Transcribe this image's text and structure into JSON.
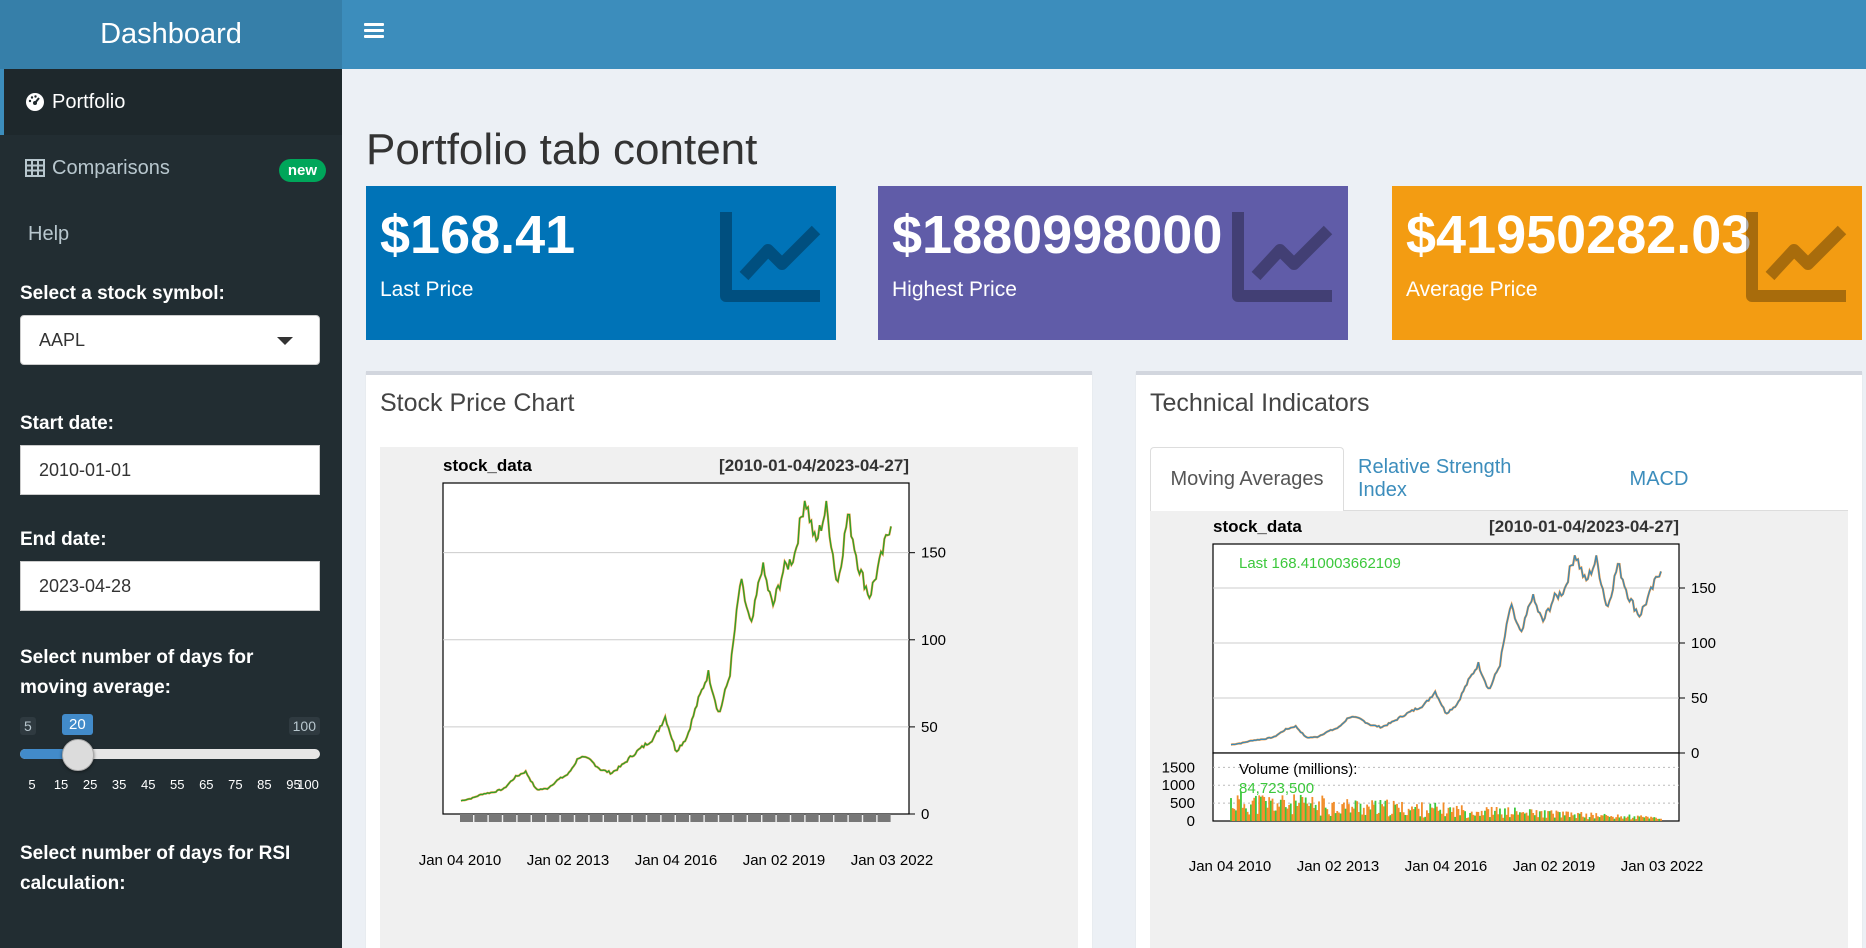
{
  "header": {
    "brand": "Dashboard",
    "menu_icon": "hamburger-icon",
    "colors": {
      "brand_bg": "#367fa9",
      "navbar_bg": "#3c8dbc"
    }
  },
  "sidebar": {
    "items": [
      {
        "label": "Portfolio",
        "icon": "dashboard-icon",
        "active": true
      },
      {
        "label": "Comparisons",
        "icon": "table-icon",
        "badge": "new"
      },
      {
        "label": "Help"
      }
    ],
    "stock_select": {
      "label": "Select a stock symbol:",
      "value": "AAPL"
    },
    "start_date": {
      "label": "Start date:",
      "value": "2010-01-01"
    },
    "end_date": {
      "label": "End date:",
      "value": "2023-04-28"
    },
    "ma_slider": {
      "label": "Select number of days for moving average:",
      "min": "5",
      "max": "100",
      "value": "20",
      "ticks": [
        "5",
        "15",
        "25",
        "35",
        "45",
        "55",
        "65",
        "75",
        "85",
        "95",
        "100"
      ]
    },
    "rsi_label": "Select number of days for RSI calculation:"
  },
  "main": {
    "title": "Portfolio tab content",
    "value_boxes": [
      {
        "value": "$168.41",
        "subtitle": "Last Price",
        "color": "#0073b7",
        "icon": "line-chart-icon"
      },
      {
        "value": "$1880998000",
        "subtitle": "Highest Price",
        "color": "#605ca8",
        "icon": "line-chart-icon"
      },
      {
        "value": "$41950282.03",
        "subtitle": "Average Price",
        "color": "#f39c12",
        "icon": "line-chart-icon"
      }
    ],
    "stock_box": {
      "title": "Stock Price Chart"
    },
    "tech_box": {
      "title": "Technical Indicators",
      "tabs": [
        "Moving Averages",
        "Relative Strength Index",
        "MACD"
      ],
      "active_tab": 0
    }
  },
  "chart_data": [
    {
      "type": "line",
      "title": "stock_data",
      "subtitle": "[2010-01-04/2023-04-27]",
      "x": [
        "2010-01-04",
        "2010-07-01",
        "2011-01-03",
        "2011-07-01",
        "2012-01-03",
        "2012-04-02",
        "2012-09-19",
        "2013-04-19",
        "2013-07-01",
        "2014-01-02",
        "2014-07-01",
        "2015-02-23",
        "2015-07-01",
        "2016-01-04",
        "2016-05-12",
        "2016-10-03",
        "2017-03-01",
        "2017-10-02",
        "2018-03-01",
        "2018-10-03",
        "2019-01-03",
        "2019-06-03",
        "2019-12-02",
        "2020-02-21",
        "2020-03-23",
        "2020-06-01",
        "2020-09-01",
        "2020-09-22",
        "2021-01-26",
        "2021-03-08",
        "2021-07-06",
        "2021-11-01",
        "2022-01-03",
        "2022-03-14",
        "2022-04-04",
        "2022-06-16",
        "2022-08-17",
        "2022-10-03",
        "2023-01-03",
        "2023-02-01",
        "2023-04-27"
      ],
      "y": [
        7.6,
        9,
        11.5,
        12.5,
        14.5,
        21,
        24.5,
        14,
        14.5,
        19.5,
        23,
        33,
        31,
        25.5,
        23.5,
        28,
        34,
        39,
        44,
        56,
        36,
        44,
        64,
        81,
        57,
        80,
        134,
        107,
        143,
        119,
        140,
        148,
        182,
        155,
        176,
        131,
        172,
        142,
        125,
        145,
        168
      ],
      "xticks": [
        "Jan 04 2010",
        "Jan 02 2013",
        "Jan 04 2016",
        "Jan 02 2019",
        "Jan 03 2022"
      ],
      "yticks": [
        "0",
        "50",
        "100",
        "150"
      ],
      "ylim": [
        0,
        190
      ],
      "grid": true
    },
    {
      "type": "line",
      "title": "stock_data",
      "subtitle": "[2010-01-04/2023-04-27]",
      "annotation": "Last 168.410003662109",
      "y": [
        7.6,
        9,
        11.5,
        12.5,
        14.5,
        21,
        24.5,
        14,
        14.5,
        19.5,
        23,
        33,
        31,
        25.5,
        23.5,
        28,
        34,
        39,
        44,
        56,
        36,
        44,
        64,
        81,
        57,
        80,
        134,
        107,
        143,
        119,
        140,
        148,
        182,
        155,
        176,
        131,
        172,
        142,
        125,
        145,
        168
      ],
      "xticks": [
        "Jan 04 2010",
        "Jan 02 2013",
        "Jan 04 2016",
        "Jan 02 2019",
        "Jan 03 2022"
      ],
      "yticks": [
        "0",
        "50",
        "100",
        "150"
      ],
      "ylim": [
        0,
        190
      ],
      "volume_panel": {
        "label": "Volume (millions):",
        "last": "84,723,500",
        "yticks": [
          "0",
          "500",
          "1000",
          "1500"
        ],
        "ylim": [
          0,
          1900
        ]
      }
    }
  ]
}
